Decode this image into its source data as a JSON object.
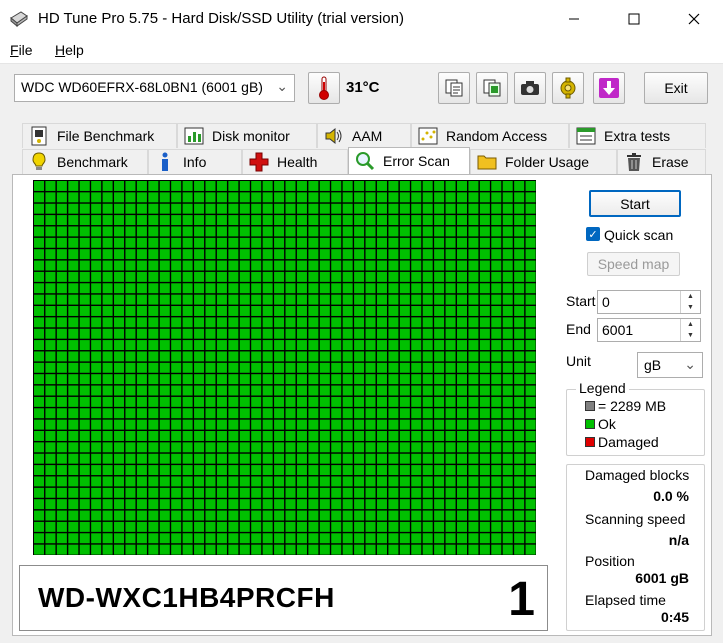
{
  "window": {
    "title": "HD Tune Pro 5.75 - Hard Disk/SSD Utility (trial version)",
    "minimize_icon": "minimize-icon",
    "maximize_icon": "maximize-icon",
    "close_icon": "close-icon"
  },
  "menu": {
    "file_first": "F",
    "file_rest": "ile",
    "help_first": "H",
    "help_rest": "elp"
  },
  "toolbar": {
    "drive": "WDC WD60EFRX-68L0BN1 (6001 gB)",
    "temperature": "31°C",
    "exit_label": "Exit",
    "icons": [
      "thermometer-icon",
      "copy-text-icon",
      "copy-info-icon",
      "screenshot-camera-icon",
      "options-icon",
      "save-download-icon"
    ]
  },
  "tabs": {
    "row1": [
      "File Benchmark",
      "Disk monitor",
      "AAM",
      "Random Access",
      "Extra tests"
    ],
    "row2": [
      "Benchmark",
      "Info",
      "Health",
      "Error Scan",
      "Folder Usage",
      "Erase"
    ],
    "active": "Error Scan"
  },
  "scan": {
    "grid_cols": 44,
    "grid_rows": 33,
    "status_colors": {
      "ok": "#00c000",
      "damaged": "#e00000",
      "block": "#808080"
    },
    "serial": "WD-WXC1HB4PRCFH",
    "drive_number": "1"
  },
  "controls": {
    "start_label": "Start",
    "quick_scan_label": "Quick scan",
    "quick_scan_checked": true,
    "speed_map_label": "Speed map",
    "start_field_label": "Start",
    "start_value": "0",
    "end_field_label": "End",
    "end_value": "6001",
    "unit_label": "Unit",
    "unit_value": "gB"
  },
  "legend": {
    "title": "Legend",
    "block_label": "= 2289 MB",
    "ok_label": "Ok",
    "damaged_label": "Damaged"
  },
  "stats": {
    "damaged_blocks_label": "Damaged blocks",
    "damaged_blocks_value": "0.0 %",
    "scanning_speed_label": "Scanning speed",
    "scanning_speed_value": "n/a",
    "position_label": "Position",
    "position_value": "6001 gB",
    "elapsed_label": "Elapsed time",
    "elapsed_value": "0:45"
  }
}
